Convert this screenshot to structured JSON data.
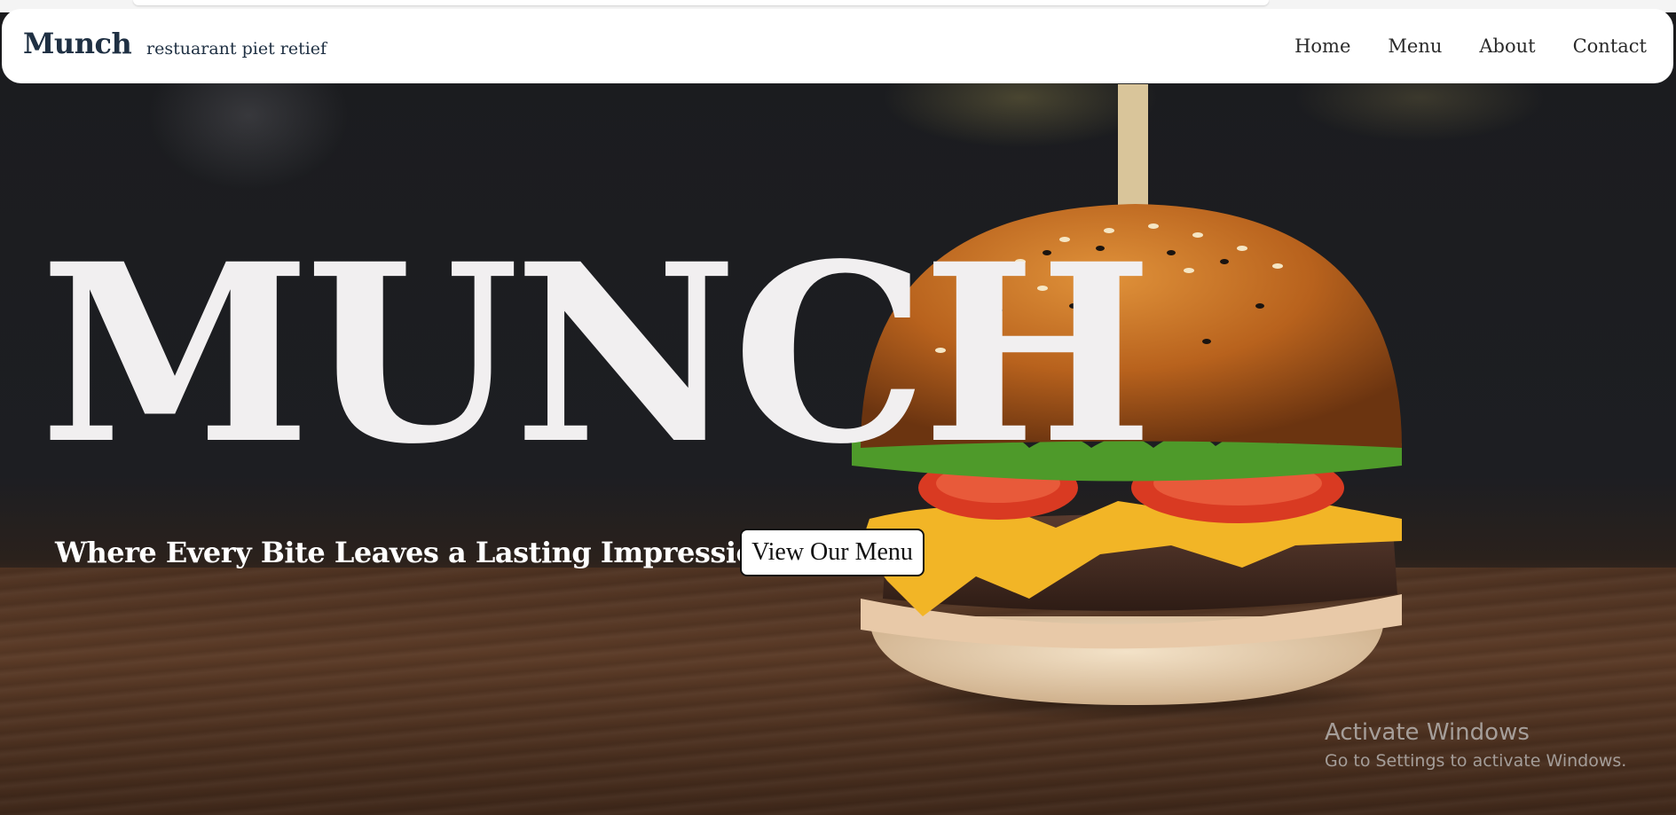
{
  "navbar": {
    "brand": "Munch",
    "tagline": "restuarant piet retief",
    "links": [
      "Home",
      "Menu",
      "About",
      "Contact"
    ]
  },
  "hero": {
    "title": "MUNCH",
    "subtitle": "Where Every Bite Leaves a Lasting Impression",
    "cta_label": "View Our Menu"
  },
  "watermark": {
    "title": "Activate Windows",
    "subtitle": "Go to Settings to activate Windows."
  },
  "colors": {
    "brand_text": "#1f3043",
    "hero_title": "#f1eff0",
    "background_dark": "#1b1c1f",
    "wood": "#4f3322"
  },
  "image": {
    "subject": "burger-photo"
  }
}
